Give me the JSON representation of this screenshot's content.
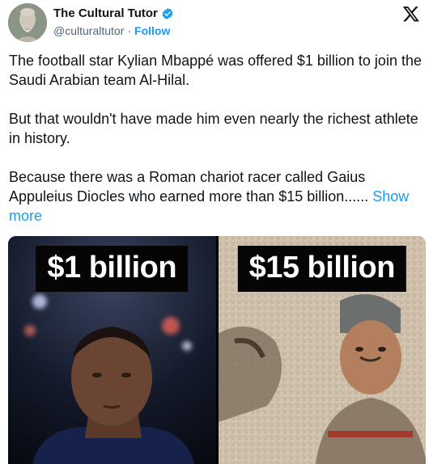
{
  "author": {
    "display_name": "The Cultural Tutor",
    "handle": "@culturaltutor",
    "separator": "·",
    "follow_label": "Follow",
    "verified_icon": "verified-badge-icon",
    "avatar_icon": "philosopher-bust-avatar"
  },
  "platform": {
    "logo_icon": "x-logo-icon"
  },
  "tweet": {
    "text": "The football star Kylian Mbappé was offered $1 billion to join the Saudi Arabian team Al-Hilal.\n\nBut that wouldn't have made him even nearly the richest athlete in history.\n\nBecause there was a Roman chariot racer called Gaius Appuleius Diocles who earned more than $15 billion...... ",
    "show_more_label": "Show more"
  },
  "media": {
    "left_caption": "$1 billion",
    "right_caption": "$15 billion",
    "left_subject": "footballer-portrait",
    "right_subject": "roman-mosaic-charioteer"
  },
  "colors": {
    "link": "#1d9bf0",
    "text": "#0f1419",
    "muted": "#536471"
  }
}
